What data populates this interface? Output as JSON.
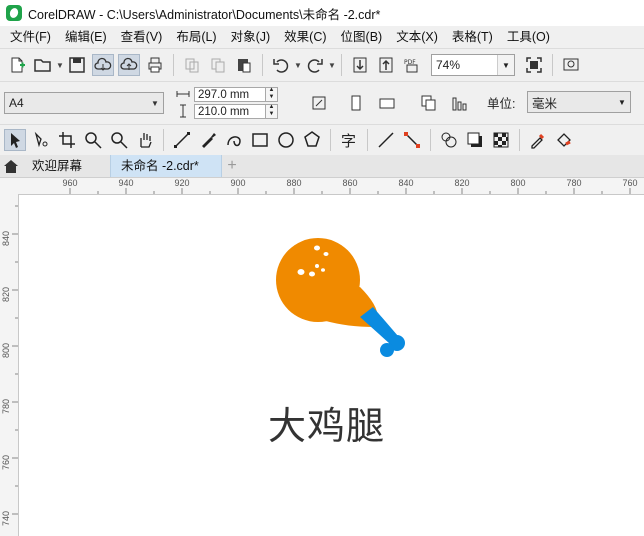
{
  "window": {
    "title": "CorelDRAW - C:\\Users\\Administrator\\Documents\\未命名 -2.cdr*"
  },
  "menu": [
    "文件(F)",
    "编辑(E)",
    "查看(V)",
    "布局(L)",
    "对象(J)",
    "效果(C)",
    "位图(B)",
    "文本(X)",
    "表格(T)",
    "工具(O)"
  ],
  "standard_toolbar": {
    "zoom_value": "74%"
  },
  "property_bar": {
    "page_size": "A4",
    "width": "297.0 mm",
    "height": "210.0 mm",
    "unit_label": "单位:",
    "unit_value": "毫米"
  },
  "tabs": {
    "welcome": "欢迎屏幕",
    "document": "未命名 -2.cdr*"
  },
  "rulers": {
    "horizontal": [
      "960",
      "940",
      "920",
      "900",
      "880",
      "860",
      "840",
      "820",
      "800",
      "780",
      "760"
    ],
    "vertical": [
      "840",
      "820",
      "800",
      "780",
      "760",
      "740"
    ]
  },
  "artwork": {
    "caption": "大鸡腿"
  },
  "colors": {
    "drumstick_meat": "#f08a00",
    "drumstick_bone": "#0a8be0",
    "accent": "#1fa34a"
  }
}
